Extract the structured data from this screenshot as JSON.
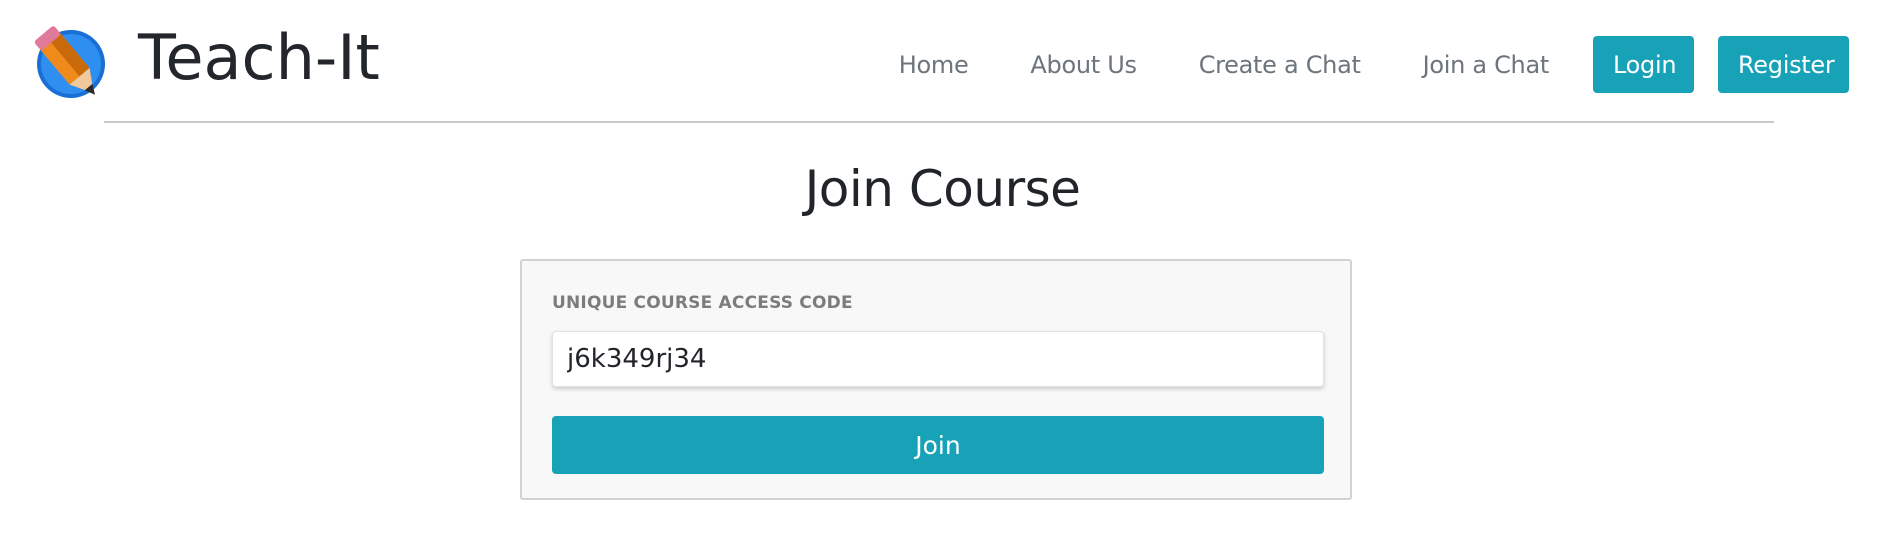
{
  "brand": {
    "name": "Teach-It",
    "logo_icon": "pencil-logo-icon"
  },
  "nav": {
    "links": [
      {
        "label": "Home"
      },
      {
        "label": "About Us"
      },
      {
        "label": "Create a Chat"
      },
      {
        "label": "Join a Chat"
      }
    ],
    "login_label": "Login",
    "register_label": "Register"
  },
  "main": {
    "title": "Join Course",
    "form": {
      "code_label": "UNIQUE COURSE ACCESS CODE",
      "code_value": "j6k349rj34",
      "join_label": "Join"
    }
  },
  "colors": {
    "accent": "#17a2b8",
    "nav_text": "#6c757d",
    "label_text": "#7c7c7c"
  }
}
